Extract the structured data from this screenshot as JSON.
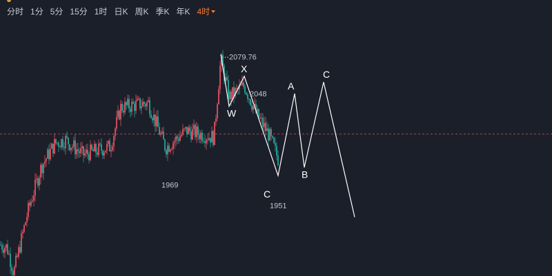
{
  "toolbar": {
    "items": [
      {
        "label": "分时"
      },
      {
        "label": "1分"
      },
      {
        "label": "5分"
      },
      {
        "label": "15分"
      },
      {
        "label": "1时"
      },
      {
        "label": "日K"
      },
      {
        "label": "周K"
      },
      {
        "label": "季K"
      },
      {
        "label": "年K"
      },
      {
        "label": "4时",
        "active": true
      }
    ]
  },
  "colors": {
    "background": "#1b1f29",
    "up": "#e0525f",
    "down": "#26a69a",
    "active_tab": "#ff7a2e",
    "wave_line": "#ffffff",
    "reference_line": "#b2454d"
  },
  "chart_data": {
    "type": "candlestick",
    "y_range": [
      1890,
      2110
    ],
    "reference_line": 2013,
    "price_labels": [
      {
        "text": "2079.76",
        "value": 2079.76,
        "marker": "⋯"
      },
      {
        "text": "2048",
        "value": 2048
      },
      {
        "text": "1969",
        "value": 1969
      },
      {
        "text": "1951",
        "value": 1951
      }
    ],
    "wave_labels": [
      "W",
      "X",
      "C",
      "A",
      "B",
      "C"
    ],
    "wave_path": {
      "start": 2082,
      "pivots": [
        {
          "name": "W",
          "value": 2037
        },
        {
          "name": "X",
          "value": 2063
        },
        {
          "name": "C",
          "value": 1977
        },
        {
          "name": "A",
          "value": 2048
        },
        {
          "name": "B",
          "value": 1984
        },
        {
          "name": "C",
          "value": 2058
        }
      ],
      "end": 1941
    }
  }
}
